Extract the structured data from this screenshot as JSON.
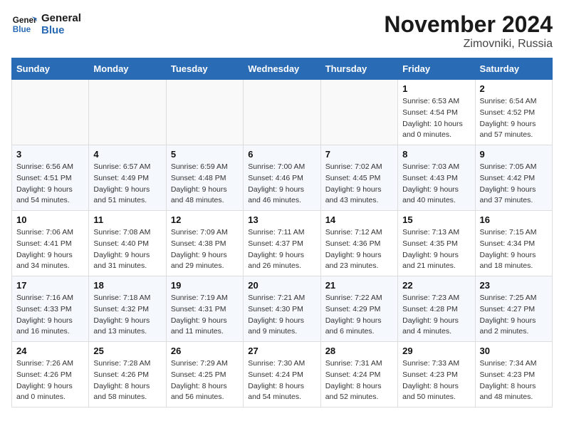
{
  "header": {
    "logo_line1": "General",
    "logo_line2": "Blue",
    "month": "November 2024",
    "location": "Zimovniki, Russia"
  },
  "weekdays": [
    "Sunday",
    "Monday",
    "Tuesday",
    "Wednesday",
    "Thursday",
    "Friday",
    "Saturday"
  ],
  "weeks": [
    [
      {
        "day": "",
        "info": ""
      },
      {
        "day": "",
        "info": ""
      },
      {
        "day": "",
        "info": ""
      },
      {
        "day": "",
        "info": ""
      },
      {
        "day": "",
        "info": ""
      },
      {
        "day": "1",
        "info": "Sunrise: 6:53 AM\nSunset: 4:54 PM\nDaylight: 10 hours\nand 0 minutes."
      },
      {
        "day": "2",
        "info": "Sunrise: 6:54 AM\nSunset: 4:52 PM\nDaylight: 9 hours\nand 57 minutes."
      }
    ],
    [
      {
        "day": "3",
        "info": "Sunrise: 6:56 AM\nSunset: 4:51 PM\nDaylight: 9 hours\nand 54 minutes."
      },
      {
        "day": "4",
        "info": "Sunrise: 6:57 AM\nSunset: 4:49 PM\nDaylight: 9 hours\nand 51 minutes."
      },
      {
        "day": "5",
        "info": "Sunrise: 6:59 AM\nSunset: 4:48 PM\nDaylight: 9 hours\nand 48 minutes."
      },
      {
        "day": "6",
        "info": "Sunrise: 7:00 AM\nSunset: 4:46 PM\nDaylight: 9 hours\nand 46 minutes."
      },
      {
        "day": "7",
        "info": "Sunrise: 7:02 AM\nSunset: 4:45 PM\nDaylight: 9 hours\nand 43 minutes."
      },
      {
        "day": "8",
        "info": "Sunrise: 7:03 AM\nSunset: 4:43 PM\nDaylight: 9 hours\nand 40 minutes."
      },
      {
        "day": "9",
        "info": "Sunrise: 7:05 AM\nSunset: 4:42 PM\nDaylight: 9 hours\nand 37 minutes."
      }
    ],
    [
      {
        "day": "10",
        "info": "Sunrise: 7:06 AM\nSunset: 4:41 PM\nDaylight: 9 hours\nand 34 minutes."
      },
      {
        "day": "11",
        "info": "Sunrise: 7:08 AM\nSunset: 4:40 PM\nDaylight: 9 hours\nand 31 minutes."
      },
      {
        "day": "12",
        "info": "Sunrise: 7:09 AM\nSunset: 4:38 PM\nDaylight: 9 hours\nand 29 minutes."
      },
      {
        "day": "13",
        "info": "Sunrise: 7:11 AM\nSunset: 4:37 PM\nDaylight: 9 hours\nand 26 minutes."
      },
      {
        "day": "14",
        "info": "Sunrise: 7:12 AM\nSunset: 4:36 PM\nDaylight: 9 hours\nand 23 minutes."
      },
      {
        "day": "15",
        "info": "Sunrise: 7:13 AM\nSunset: 4:35 PM\nDaylight: 9 hours\nand 21 minutes."
      },
      {
        "day": "16",
        "info": "Sunrise: 7:15 AM\nSunset: 4:34 PM\nDaylight: 9 hours\nand 18 minutes."
      }
    ],
    [
      {
        "day": "17",
        "info": "Sunrise: 7:16 AM\nSunset: 4:33 PM\nDaylight: 9 hours\nand 16 minutes."
      },
      {
        "day": "18",
        "info": "Sunrise: 7:18 AM\nSunset: 4:32 PM\nDaylight: 9 hours\nand 13 minutes."
      },
      {
        "day": "19",
        "info": "Sunrise: 7:19 AM\nSunset: 4:31 PM\nDaylight: 9 hours\nand 11 minutes."
      },
      {
        "day": "20",
        "info": "Sunrise: 7:21 AM\nSunset: 4:30 PM\nDaylight: 9 hours\nand 9 minutes."
      },
      {
        "day": "21",
        "info": "Sunrise: 7:22 AM\nSunset: 4:29 PM\nDaylight: 9 hours\nand 6 minutes."
      },
      {
        "day": "22",
        "info": "Sunrise: 7:23 AM\nSunset: 4:28 PM\nDaylight: 9 hours\nand 4 minutes."
      },
      {
        "day": "23",
        "info": "Sunrise: 7:25 AM\nSunset: 4:27 PM\nDaylight: 9 hours\nand 2 minutes."
      }
    ],
    [
      {
        "day": "24",
        "info": "Sunrise: 7:26 AM\nSunset: 4:26 PM\nDaylight: 9 hours\nand 0 minutes."
      },
      {
        "day": "25",
        "info": "Sunrise: 7:28 AM\nSunset: 4:26 PM\nDaylight: 8 hours\nand 58 minutes."
      },
      {
        "day": "26",
        "info": "Sunrise: 7:29 AM\nSunset: 4:25 PM\nDaylight: 8 hours\nand 56 minutes."
      },
      {
        "day": "27",
        "info": "Sunrise: 7:30 AM\nSunset: 4:24 PM\nDaylight: 8 hours\nand 54 minutes."
      },
      {
        "day": "28",
        "info": "Sunrise: 7:31 AM\nSunset: 4:24 PM\nDaylight: 8 hours\nand 52 minutes."
      },
      {
        "day": "29",
        "info": "Sunrise: 7:33 AM\nSunset: 4:23 PM\nDaylight: 8 hours\nand 50 minutes."
      },
      {
        "day": "30",
        "info": "Sunrise: 7:34 AM\nSunset: 4:23 PM\nDaylight: 8 hours\nand 48 minutes."
      }
    ]
  ]
}
